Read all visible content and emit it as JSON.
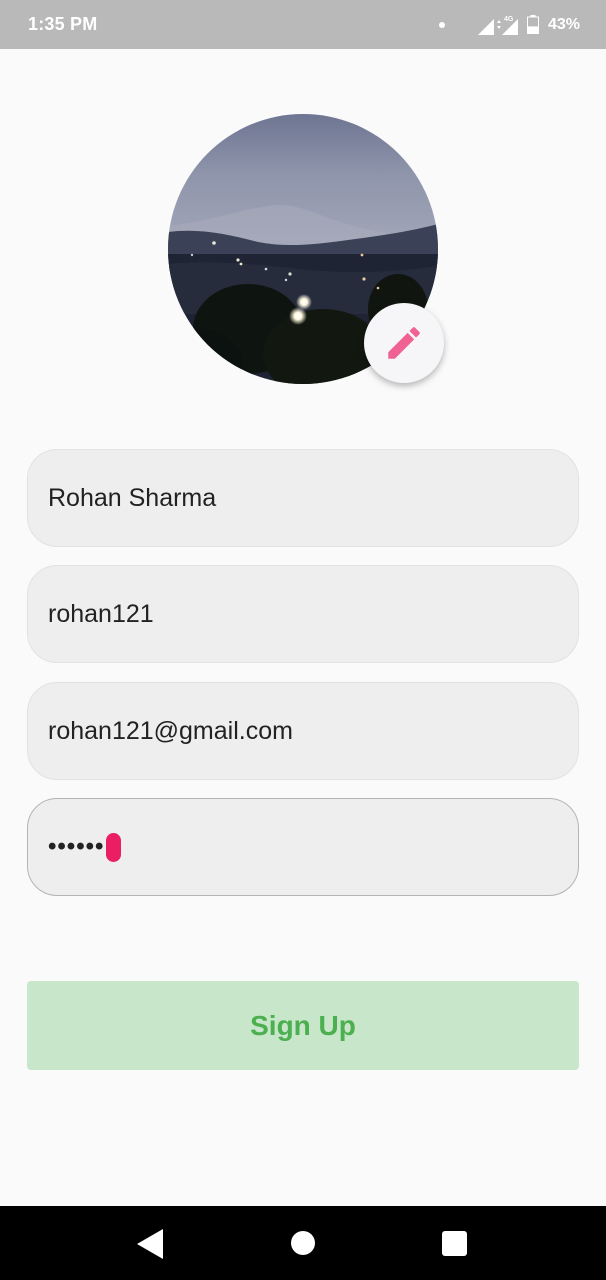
{
  "status_bar": {
    "time": "1:35 PM",
    "network_label": "4G",
    "battery_percent": "43%",
    "battery_level": 0.43,
    "icons": [
      "notification-dot-icon",
      "wifi-signal-icon",
      "data-arrows-icon",
      "cell-signal-icon",
      "battery-icon"
    ]
  },
  "profile": {
    "avatar_icon": "avatar-photo",
    "edit_icon": "pencil-icon",
    "accent_color": "#f06292"
  },
  "form": {
    "name_value": "Rohan Sharma",
    "username_value": "rohan121",
    "email_value": "rohan121@gmail.com",
    "password_value": "••••••",
    "cursor_color": "#e91e63"
  },
  "signup": {
    "label": "Sign Up",
    "background_color": "#c8e6c9",
    "text_color": "#4caf50"
  },
  "nav_bar": {
    "icons": [
      "back-icon",
      "home-icon",
      "recents-icon"
    ]
  }
}
